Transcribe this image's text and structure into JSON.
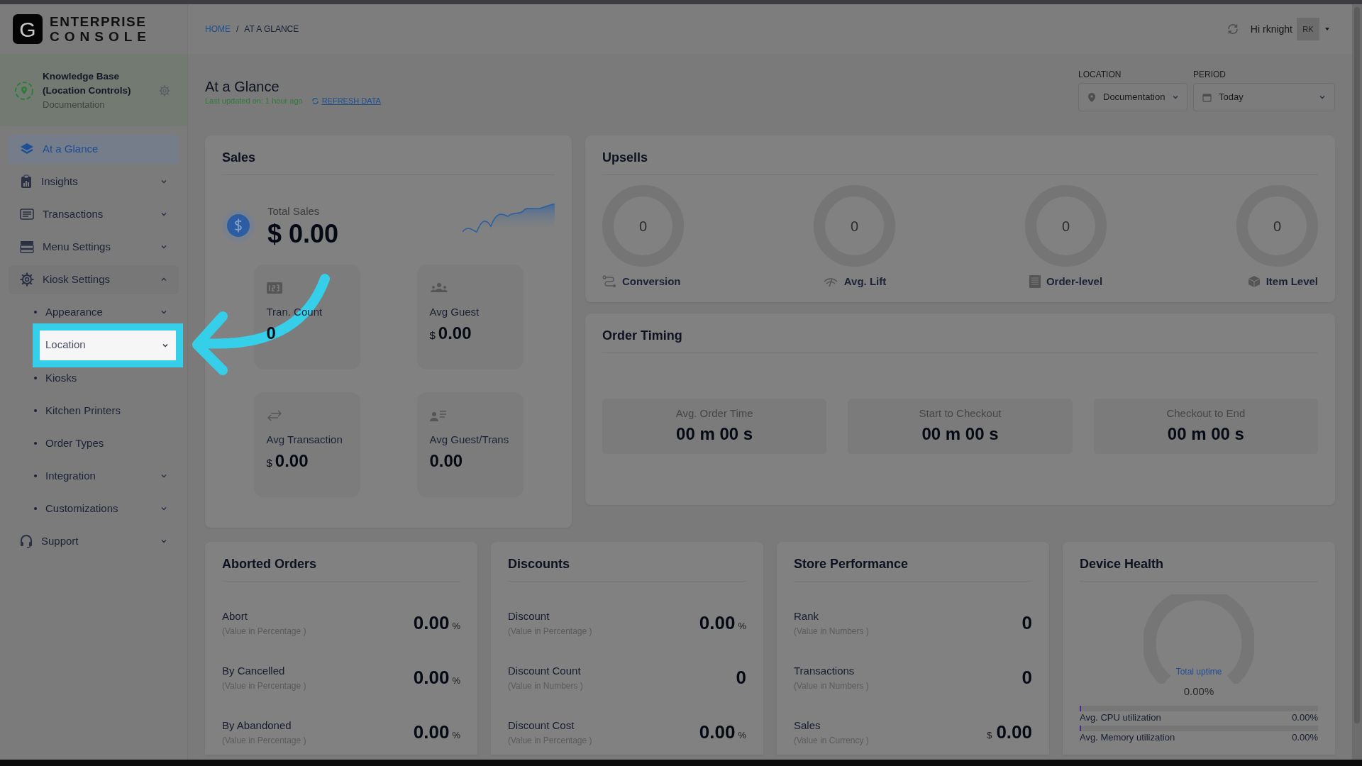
{
  "brand": {
    "logo_letter": "G",
    "line1": "ENTERPRISE",
    "line2": "CONSOLE"
  },
  "breadcrumb": {
    "items": [
      {
        "label": "HOME",
        "kind": "link"
      },
      {
        "label": "AT A GLANCE",
        "kind": "current"
      }
    ],
    "separator": "/"
  },
  "user": {
    "greeting": "Hi rknight",
    "initials": "RK"
  },
  "location_panel": {
    "title": "Knowledge Base (Location Controls)",
    "subtitle": "Documentation"
  },
  "sidebar": {
    "items": [
      {
        "label": "At a Glance",
        "selected": true,
        "expandable": false,
        "expanded": false
      },
      {
        "label": "Insights",
        "selected": false,
        "expandable": true,
        "expanded": false
      },
      {
        "label": "Transactions",
        "selected": false,
        "expandable": true,
        "expanded": false
      },
      {
        "label": "Menu Settings",
        "selected": false,
        "expandable": true,
        "expanded": false
      },
      {
        "label": "Kiosk Settings",
        "selected": false,
        "expandable": true,
        "expanded": true,
        "children": [
          {
            "label": "Appearance",
            "expandable": true,
            "highlighted": false
          },
          {
            "label": "Location",
            "expandable": true,
            "highlighted": true
          },
          {
            "label": "Kiosks",
            "expandable": false,
            "highlighted": false
          },
          {
            "label": "Kitchen Printers",
            "expandable": false,
            "highlighted": false
          },
          {
            "label": "Order Types",
            "expandable": false,
            "highlighted": false
          },
          {
            "label": "Integration",
            "expandable": true,
            "highlighted": false
          },
          {
            "label": "Customizations",
            "expandable": true,
            "highlighted": false
          }
        ]
      },
      {
        "label": "Support",
        "selected": false,
        "expandable": true,
        "expanded": false
      }
    ]
  },
  "page": {
    "title": "At a Glance",
    "updated": "Last updated on: 1 hour ago",
    "refresh": "REFRESH DATA"
  },
  "filters": [
    {
      "label": "LOCATION",
      "value": "Documentation"
    },
    {
      "label": "PERIOD",
      "value": "Today"
    }
  ],
  "sales": {
    "title": "Sales",
    "total_label": "Total Sales",
    "total": "$ 0.00",
    "stats": [
      {
        "label": "Tran. Count",
        "value": "0"
      },
      {
        "label": "Avg Guest",
        "prefix": "$",
        "value": "0.00"
      },
      {
        "label": "Avg Transaction",
        "prefix": "$",
        "value": "0.00"
      },
      {
        "label": "Avg Guest/Trans",
        "value": "0.00"
      }
    ]
  },
  "upsells": {
    "title": "Upsells",
    "items": [
      {
        "value": "0",
        "label": "Conversion"
      },
      {
        "value": "0",
        "label": "Avg. Lift"
      },
      {
        "value": "0",
        "label": "Order-level"
      },
      {
        "value": "0",
        "label": "Item Level"
      }
    ]
  },
  "order_timing": {
    "title": "Order Timing",
    "items": [
      {
        "label": "Avg. Order Time",
        "value": "00 m 00 s"
      },
      {
        "label": "Start to Checkout",
        "value": "00 m 00 s"
      },
      {
        "label": "Checkout to End",
        "value": "00 m 00 s"
      }
    ]
  },
  "metric_cards": [
    {
      "title": "Aborted Orders",
      "rows": [
        {
          "label": "Abort",
          "note": "(Value in Percentage )",
          "value": "0.00",
          "unit": "%"
        },
        {
          "label": "By Cancelled",
          "note": "(Value in Percentage )",
          "value": "0.00",
          "unit": "%"
        },
        {
          "label": "By Abandoned",
          "note": "(Value in Percentage )",
          "value": "0.00",
          "unit": "%"
        }
      ]
    },
    {
      "title": "Discounts",
      "rows": [
        {
          "label": "Discount",
          "note": "(Value in Percentage )",
          "value": "0.00",
          "unit": "%"
        },
        {
          "label": "Discount Count",
          "note": "(Value in Numbers )",
          "value": "0"
        },
        {
          "label": "Discount Cost",
          "note": "(Value in Percentage )",
          "value": "0.00",
          "unit": "%"
        }
      ]
    },
    {
      "title": "Store Performance",
      "rows": [
        {
          "label": "Rank",
          "note": "(Value in Numbers )",
          "value": "0"
        },
        {
          "label": "Transactions",
          "note": "(Value in Numbers )",
          "value": "0"
        },
        {
          "label": "Sales",
          "note": "(Value in Currency )",
          "prefix": "$",
          "value": "0.00"
        }
      ]
    }
  ],
  "device_health": {
    "title": "Device Health",
    "gauge_label": "Total uptime",
    "uptime": "0.00%",
    "bars": [
      {
        "label": "Avg. CPU utilization",
        "value": "0.00%",
        "level": 0
      },
      {
        "label": "Avg. Memory utilization",
        "value": "0.00%",
        "level": 0
      }
    ]
  }
}
